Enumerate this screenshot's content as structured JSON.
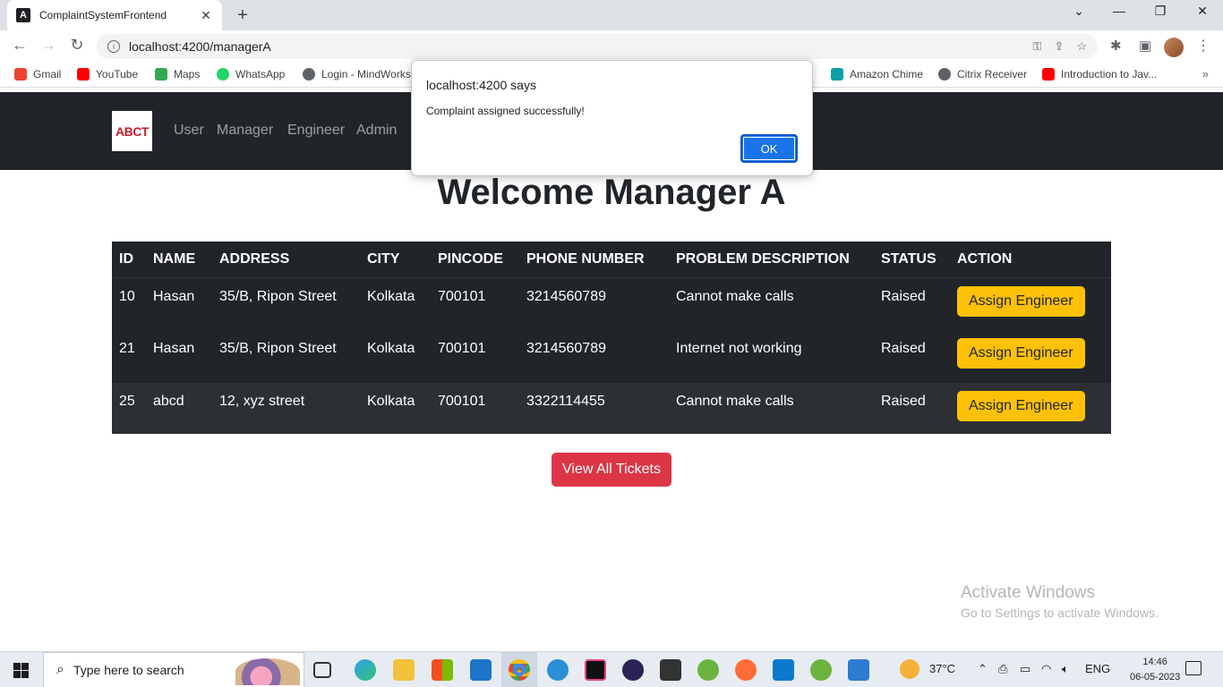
{
  "browser": {
    "tab_title": "ComplaintSystemFrontend",
    "url": "localhost:4200/managerA",
    "bookmarks": [
      {
        "label": "Gmail",
        "color": "#ea4335"
      },
      {
        "label": "YouTube",
        "color": "#ff0000"
      },
      {
        "label": "Maps",
        "color": "#34a853"
      },
      {
        "label": "WhatsApp",
        "color": "#25d366"
      },
      {
        "label": "Login - MindWorks",
        "color": "#3c4043"
      },
      {
        "label": "Amazon Chime",
        "color": "#0aa0a8"
      },
      {
        "label": "Citrix Receiver",
        "color": "#3c4043"
      },
      {
        "label": "Introduction to Jav...",
        "color": "#ff0000"
      }
    ]
  },
  "app": {
    "logo_text": "ABCT",
    "nav": [
      "User",
      "Manager",
      "Engineer",
      "Admin"
    ],
    "heading": "Welcome Manager A",
    "table": {
      "headers": [
        "ID",
        "NAME",
        "ADDRESS",
        "CITY",
        "PINCODE",
        "PHONE NUMBER",
        "PROBLEM DESCRIPTION",
        "STATUS",
        "ACTION"
      ],
      "rows": [
        {
          "id": "10",
          "name": "Hasan",
          "address": "35/B, Ripon Street",
          "city": "Kolkata",
          "pincode": "700101",
          "phone": "3214560789",
          "problem": "Cannot make calls",
          "status": "Raised",
          "action": "Assign Engineer"
        },
        {
          "id": "21",
          "name": "Hasan",
          "address": "35/B, Ripon Street",
          "city": "Kolkata",
          "pincode": "700101",
          "phone": "3214560789",
          "problem": "Internet not working",
          "status": "Raised",
          "action": "Assign Engineer"
        },
        {
          "id": "25",
          "name": "abcd",
          "address": "12, xyz street",
          "city": "Kolkata",
          "pincode": "700101",
          "phone": "3322114455",
          "problem": "Cannot make calls",
          "status": "Raised",
          "action": "Assign Engineer"
        }
      ]
    },
    "view_all_label": "View All Tickets"
  },
  "dialog": {
    "title": "localhost:4200 says",
    "message": "Complaint assigned successfully!",
    "ok_label": "OK"
  },
  "watermark": {
    "line1": "Activate Windows",
    "line2": "Go to Settings to activate Windows."
  },
  "taskbar": {
    "search_placeholder": "Type here to search",
    "weather": "37°C",
    "language": "ENG",
    "time": "14:46",
    "date": "06-05-2023"
  }
}
